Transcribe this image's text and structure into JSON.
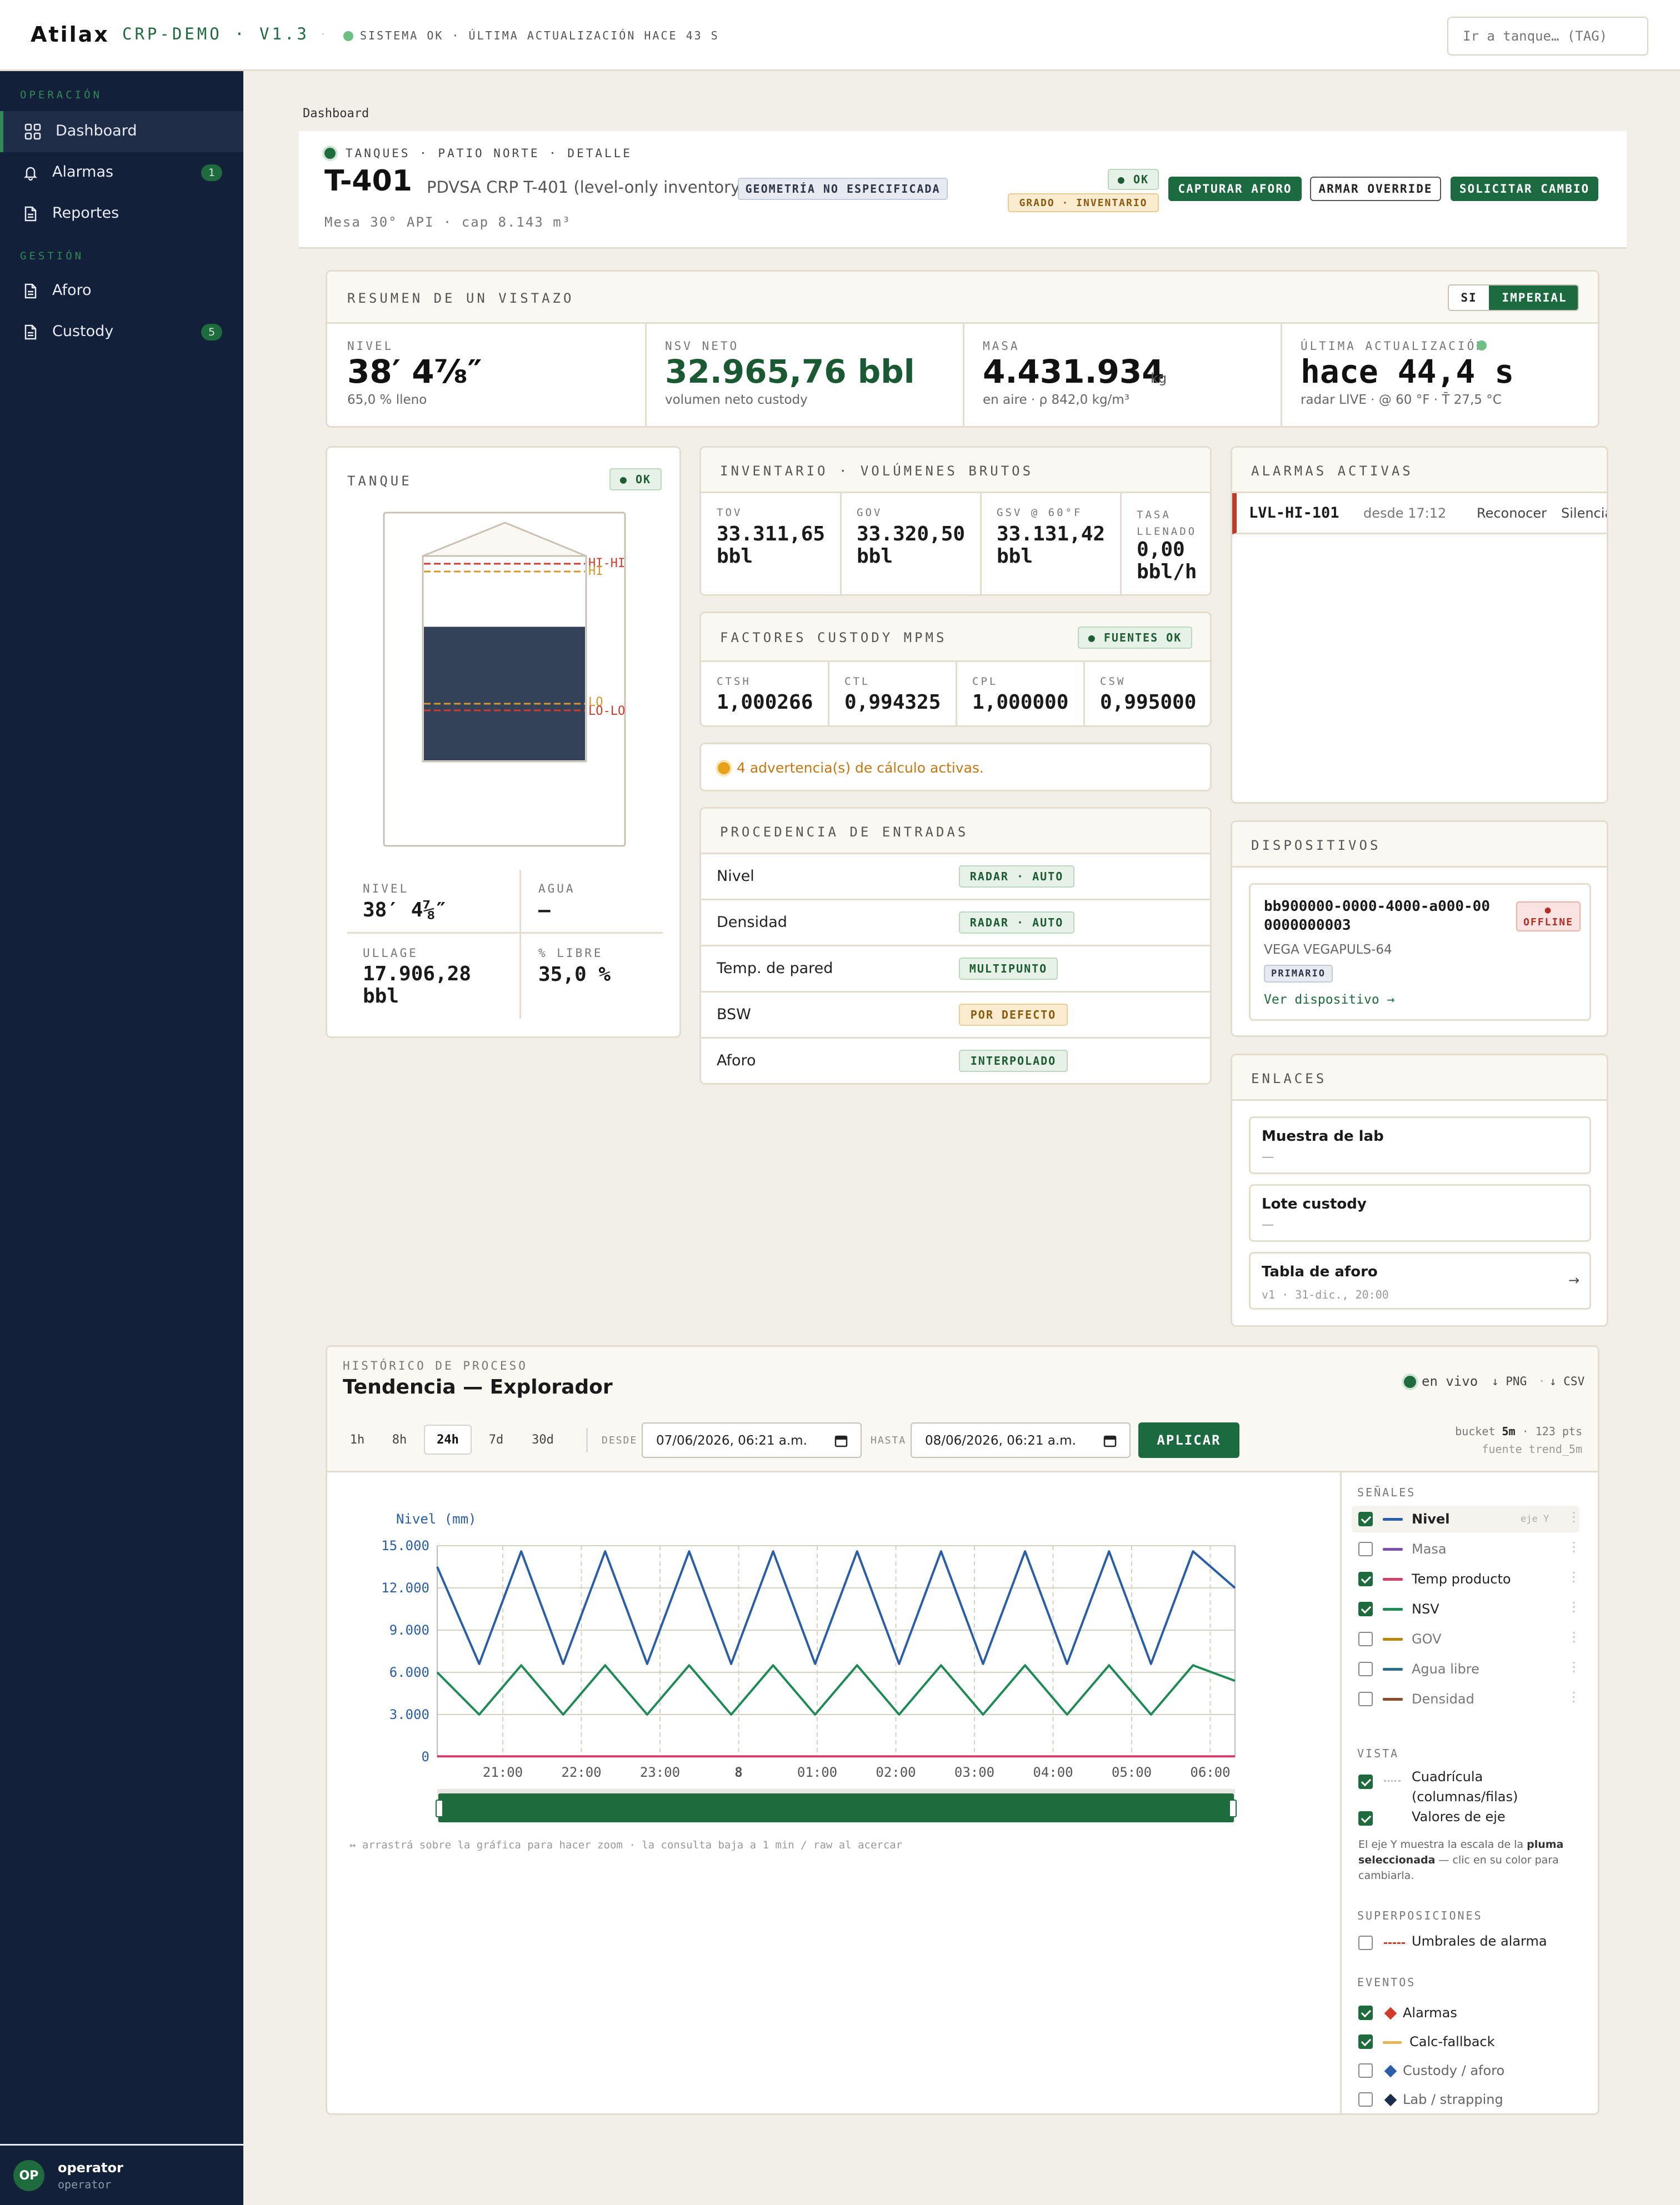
{
  "topbar": {
    "brand": "Atilax",
    "env": "CRP-DEMO · V1.3",
    "sep": "·",
    "status": "SISTEMA OK · ÚLTIMA ACTUALIZACIÓN HACE 43 S",
    "search_placeholder": "Ir a tanque… (TAG)"
  },
  "sidebar": {
    "group1": "OPERACIÓN",
    "items1": [
      {
        "label": "Dashboard"
      },
      {
        "label": "Alarmas",
        "count": "1"
      },
      {
        "label": "Reportes"
      }
    ],
    "group2": "GESTIÓN",
    "items2": [
      {
        "label": "Aforo"
      },
      {
        "label": "Custody",
        "count": "5"
      }
    ],
    "user": {
      "initials": "OP",
      "name": "operator",
      "role": "operator"
    }
  },
  "breadcrumb": "Dashboard",
  "header": {
    "path": "TANQUES · PATIO NORTE · DETALLE",
    "tag": "T-401",
    "desc": "PDVSA CRP T-401 (level-only inventory)",
    "geometry_badge": "GEOMETRÍA NO ESPECIFICADA",
    "meta": "Mesa 30° API · cap 8.143 m³",
    "ok_badge": "● OK",
    "grade_badge": "GRADO · INVENTARIO",
    "btn_capture": "CAPTURAR AFORO",
    "btn_override": "ARMAR OVERRIDE",
    "btn_change": "SOLICITAR CAMBIO"
  },
  "summary": {
    "title": "RESUMEN DE UN VISTAZO",
    "unit_si": "SI",
    "unit_imperial": "IMPERIAL",
    "nivel_label": "NIVEL",
    "nivel_value": "38′ 4⅞″",
    "nivel_sub": "65,0 % lleno",
    "nsv_label": "NSV NETO",
    "nsv_value": "32.965,76 bbl",
    "nsv_sub": "volumen neto custody",
    "masa_label": "MASA",
    "masa_value": "4.431.934",
    "masa_unit": "kg",
    "masa_sub": "en aire · ρ 842,0 kg/m³",
    "upd_label": "ÚLTIMA ACTUALIZACIÓN",
    "upd_value": "hace 44,4 s",
    "upd_sub": "radar LIVE · @ 60 °F · T̄ 27,5 °C"
  },
  "tank": {
    "title": "TANQUE",
    "ok": "● OK",
    "fill_fraction": 0.65,
    "level_hihi": "HI-HI",
    "level_hi": "HI",
    "level_lo": "LO",
    "level_lolo": "LO-LO",
    "stats": [
      {
        "label": "NIVEL",
        "value": "38′ 4⅞″"
      },
      {
        "label": "AGUA",
        "value": "—"
      },
      {
        "label": "ULLAGE",
        "value": "17.906,28 bbl"
      },
      {
        "label": "% LIBRE",
        "value": "35,0 %"
      }
    ]
  },
  "inventory": {
    "title": "INVENTARIO · VOLÚMENES BRUTOS",
    "cells": [
      {
        "label": "TOV",
        "value": "33.311,65 bbl"
      },
      {
        "label": "GOV",
        "value": "33.320,50 bbl"
      },
      {
        "label": "GSV @ 60°F",
        "value": "33.131,42 bbl"
      },
      {
        "label": "TASA LLENADO",
        "value": "0,00 bbl/h"
      }
    ]
  },
  "factors": {
    "title": "FACTORES CUSTODY MPMS",
    "badge": "● FUENTES OK",
    "cells": [
      {
        "label": "CTSH",
        "value": "1,000266"
      },
      {
        "label": "CTL",
        "value": "0,994325"
      },
      {
        "label": "CPL",
        "value": "1,000000"
      },
      {
        "label": "CSW",
        "value": "0,995000"
      }
    ]
  },
  "warning": "4 advertencia(s) de cálculo activas.",
  "provenance": {
    "title": "PROCEDENCIA DE ENTRADAS",
    "rows": [
      {
        "name": "Nivel",
        "source": "RADAR · AUTO"
      },
      {
        "name": "Densidad",
        "source": "RADAR · AUTO"
      },
      {
        "name": "Temp. de pared",
        "source": "MULTIPUNTO"
      },
      {
        "name": "BSW",
        "source": "POR DEFECTO"
      },
      {
        "name": "Aforo",
        "source": "INTERPOLADO"
      }
    ]
  },
  "alarms": {
    "title": "ALARMAS ACTIVAS",
    "row": {
      "tag": "LVL-HI-101",
      "since": "desde 17:12",
      "ack": "Reconocer",
      "silence": "Silenciar"
    }
  },
  "devices": {
    "title": "DISPOSITIVOS",
    "id": "bb900000-0000-4000-a000-000000000003",
    "status": "● OFFLINE",
    "model": "VEGA VEGAPULS-64",
    "role": "PRIMARIO",
    "link": "Ver dispositivo →"
  },
  "links": {
    "title": "ENLACES",
    "items": [
      {
        "title": "Muestra de lab",
        "sub": "—"
      },
      {
        "title": "Lote custody",
        "sub": "—"
      },
      {
        "title": "Tabla de aforo",
        "sub": "v1 · 31-dic., 20:00",
        "arrow": "→"
      }
    ]
  },
  "history": {
    "kicker": "HISTÓRICO DE PROCESO",
    "title": "Tendencia — Explorador",
    "live": "en vivo",
    "png": "↓ PNG",
    "dot": "·",
    "csv": "↓ CSV",
    "ranges": [
      "1h",
      "8h",
      "24h",
      "7d",
      "30d"
    ],
    "active_range": "24h",
    "from_label": "DESDE",
    "from_value": "07/06/2026, 06:21 a.m.",
    "to_label": "HASTA",
    "to_value": "08/06/2026, 06:21 a.m.",
    "apply": "APLICAR",
    "bucket_prefix": "bucket",
    "bucket": "5m",
    "points": "· 123 pts",
    "source": "fuente trend_5m",
    "hint": "↔ arrastrá sobre la gráfica para hacer zoom · la consulta baja a 1 min / raw al acercar"
  },
  "signals": {
    "title": "SEÑALES",
    "axis_tag": "eje Y",
    "items": [
      {
        "name": "Nivel",
        "checked": true,
        "color": "#2a5ea8"
      },
      {
        "name": "Masa",
        "checked": false,
        "color": "#7a4fb0"
      },
      {
        "name": "Temp producto",
        "checked": true,
        "color": "#d2406a"
      },
      {
        "name": "NSV",
        "checked": true,
        "color": "#1e8a56"
      },
      {
        "name": "GOV",
        "checked": false,
        "color": "#b8860b"
      },
      {
        "name": "Agua libre",
        "checked": false,
        "color": "#2c6e8a"
      },
      {
        "name": "Densidad",
        "checked": false,
        "color": "#8a4b2c"
      }
    ],
    "view_title": "VISTA",
    "view_items": [
      {
        "name": "Cuadrícula (columnas/filas)",
        "checked": true
      },
      {
        "name": "Valores de eje",
        "checked": true
      }
    ],
    "note_pre": "El eje Y muestra la escala de la ",
    "note_bold": "pluma seleccionada",
    "note_post": " — clic en su color para cambiarla.",
    "overlays_title": "SUPERPOSICIONES",
    "overlay": "Umbrales de alarma",
    "events_title": "EVENTOS",
    "events": [
      {
        "name": "Alarmas",
        "checked": true,
        "color": "#d33a2c",
        "shape": "diamond"
      },
      {
        "name": "Calc-fallback",
        "checked": true,
        "color": "#e8b45a",
        "shape": "line"
      },
      {
        "name": "Custody / aforo",
        "checked": false,
        "color": "#2a5ea8",
        "shape": "diamond"
      },
      {
        "name": "Lab / strapping",
        "checked": false,
        "color": "#1a2d4a",
        "shape": "diamond"
      }
    ]
  },
  "chart_data": {
    "type": "line",
    "ylabel": "Nivel (mm)",
    "ylim": [
      0,
      15000
    ],
    "yticks": [
      "15.000",
      "12.000",
      "9.000",
      "6.000",
      "3.000",
      "0"
    ],
    "xticks": [
      "21:00",
      "22:00",
      "23:00",
      "8",
      "01:00",
      "02:00",
      "03:00",
      "04:00",
      "05:00",
      "06:00"
    ],
    "grid": true,
    "series": [
      {
        "name": "Nivel",
        "color": "#2a5ea8",
        "values": [
          13500,
          6600,
          14600,
          6600,
          14600,
          6600,
          14600,
          6600,
          14600,
          6600,
          14600,
          6600,
          14600,
          6600,
          14600,
          6600,
          14600,
          6600,
          14600,
          12000
        ]
      },
      {
        "name": "NSV",
        "color": "#1e8a56",
        "values": [
          6000,
          3000,
          6500,
          3000,
          6500,
          3000,
          6500,
          3000,
          6500,
          3000,
          6500,
          3000,
          6500,
          3000,
          6500,
          3000,
          6500,
          3000,
          6500,
          5400
        ]
      },
      {
        "name": "Temp producto",
        "color": "#d2406a",
        "values": [
          28,
          28,
          28,
          28,
          28,
          28,
          28,
          28,
          28,
          28,
          28,
          28,
          28,
          28,
          28,
          28,
          28,
          28,
          28,
          28
        ]
      }
    ]
  }
}
